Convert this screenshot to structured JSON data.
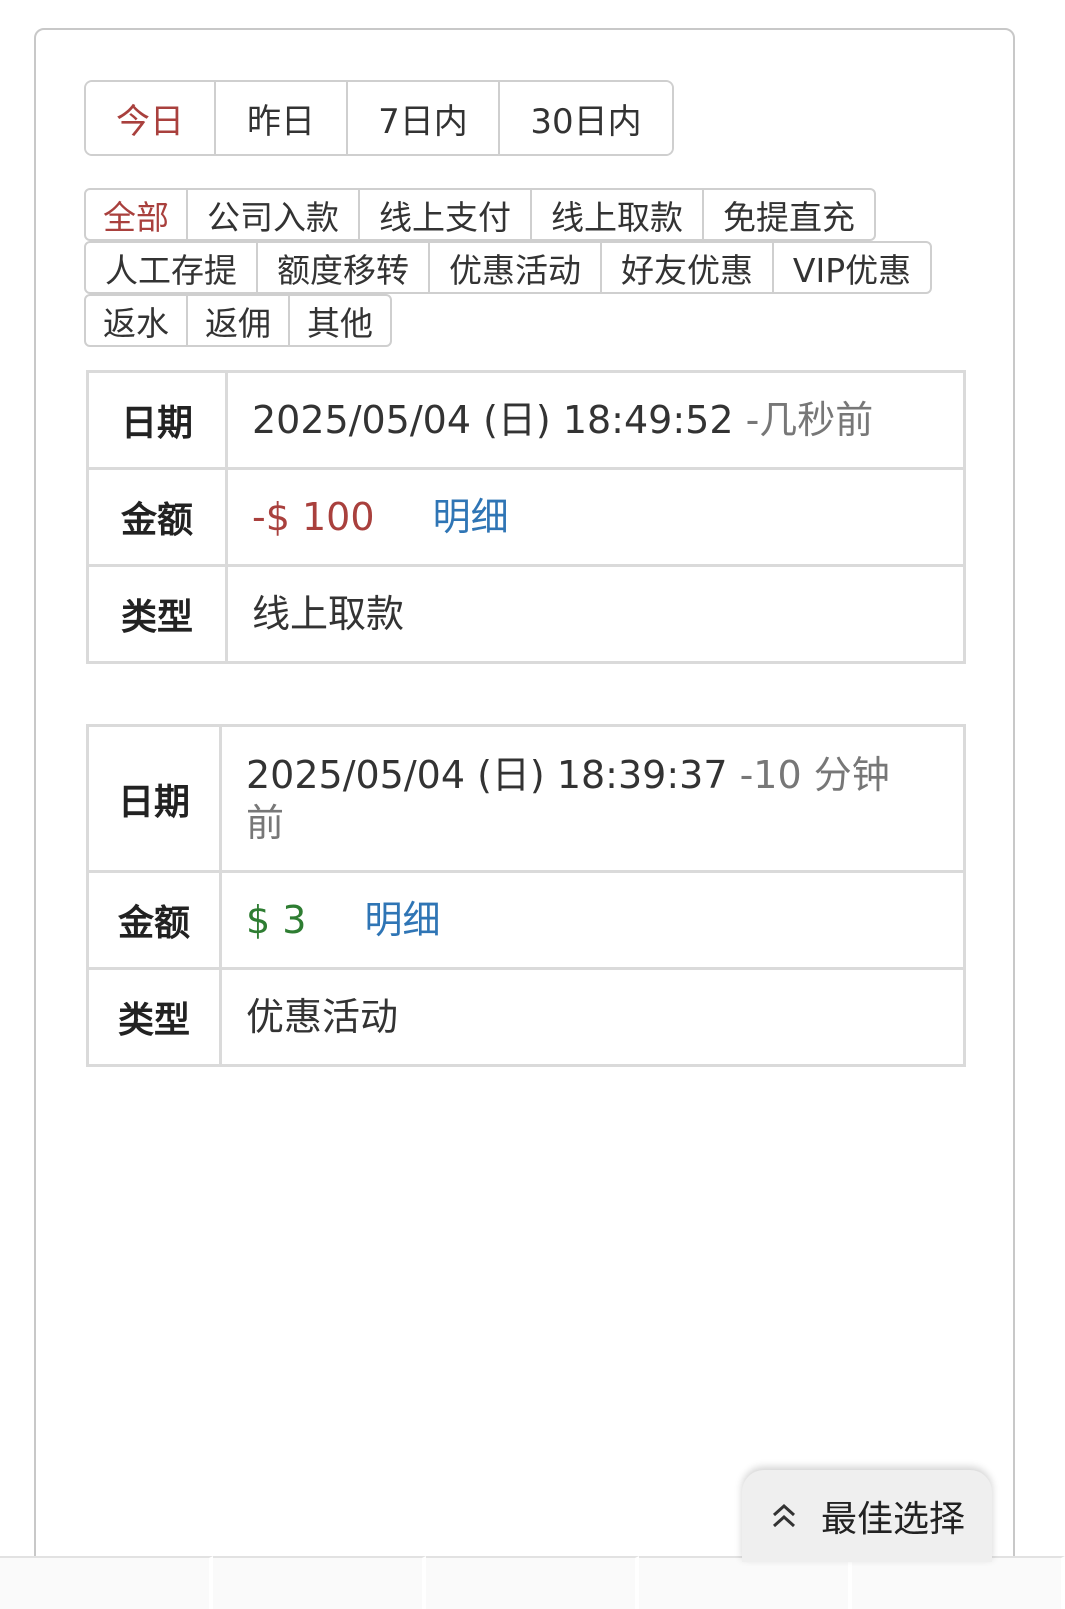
{
  "period_tabs": [
    {
      "label": "今日",
      "active": true
    },
    {
      "label": "昨日",
      "active": false
    },
    {
      "label": "7日内",
      "active": false
    },
    {
      "label": "30日内",
      "active": false
    }
  ],
  "type_filters": {
    "row1": [
      "全部",
      "公司入款",
      "线上支付",
      "线上取款",
      "免提直充"
    ],
    "row2": [
      "人工存提",
      "额度移转",
      "优惠活动",
      "好友优惠",
      "VIP优惠"
    ],
    "row3": [
      "返水",
      "返佣",
      "其他"
    ],
    "active": "全部"
  },
  "labels": {
    "date": "日期",
    "amount": "金额",
    "type": "类型",
    "detail": "明细"
  },
  "records": [
    {
      "datetime": "2025/05/04 (日) 18:49:52",
      "ago": "-几秒前",
      "amount": "-$ 100",
      "type": "线上取款"
    },
    {
      "datetime": "2025/05/04 (日) 18:39:37",
      "ago": "-10 分钟前",
      "amount": "$ 3",
      "type": "优惠活动"
    }
  ],
  "best_button": {
    "label": "最佳选择",
    "icon": "double-chevron-up-icon"
  },
  "colors": {
    "active": "#a9403d",
    "negative": "#a9403d",
    "positive": "#2e7d32",
    "link": "#2f75b5"
  }
}
